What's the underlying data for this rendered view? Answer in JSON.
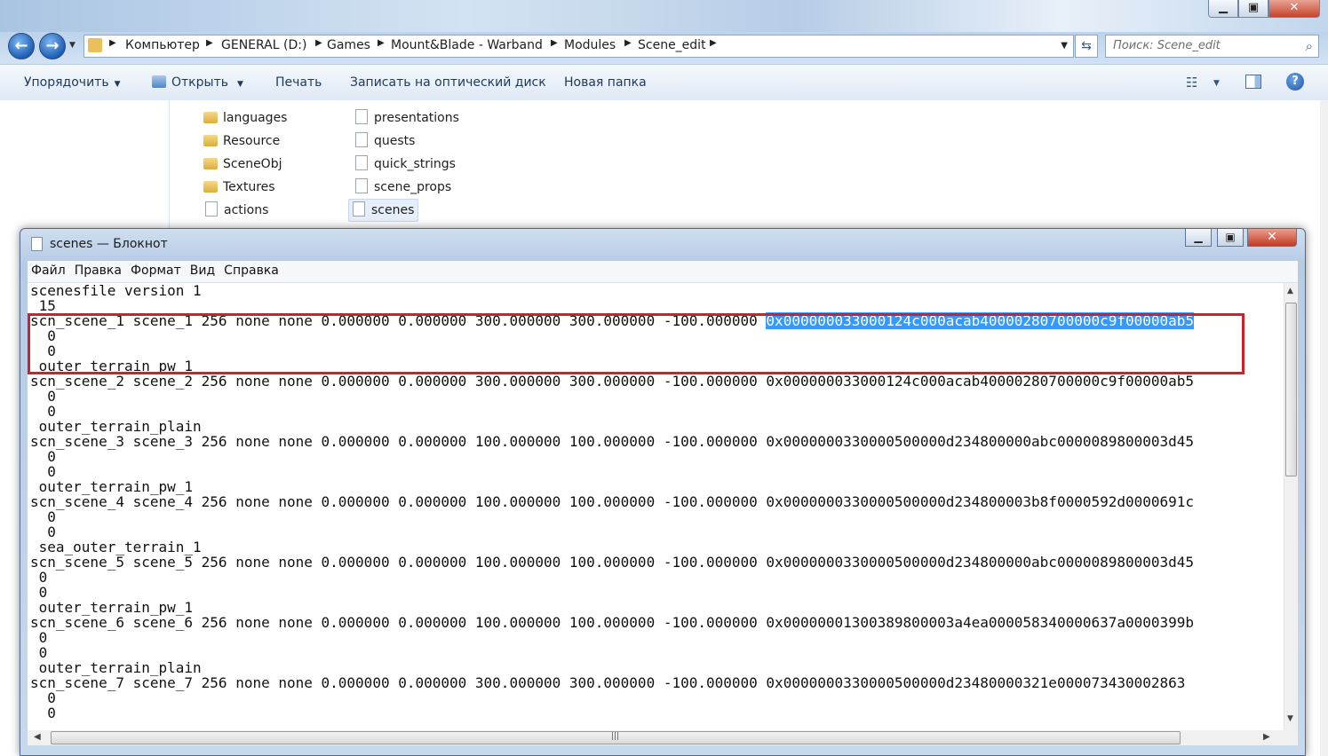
{
  "explorer": {
    "breadcrumb": [
      "Компьютер",
      "GENERAL (D:)",
      "Games",
      "Mount&Blade - Warband",
      "Modules",
      "Scene_edit"
    ],
    "search_placeholder": "Поиск: Scene_edit",
    "toolbar": {
      "organize": "Упорядочить",
      "open": "Открыть",
      "print": "Печать",
      "burn": "Записать на оптический диск",
      "new_folder": "Новая папка"
    },
    "files_col1": [
      {
        "name": "languages",
        "type": "folder"
      },
      {
        "name": "Resource",
        "type": "folder"
      },
      {
        "name": "SceneObj",
        "type": "folder"
      },
      {
        "name": "Textures",
        "type": "folder"
      },
      {
        "name": "actions",
        "type": "file"
      }
    ],
    "files_col2": [
      {
        "name": "presentations",
        "type": "file"
      },
      {
        "name": "quests",
        "type": "file"
      },
      {
        "name": "quick_strings",
        "type": "file"
      },
      {
        "name": "scene_props",
        "type": "file"
      },
      {
        "name": "scenes",
        "type": "file",
        "selected": true
      }
    ]
  },
  "notepad": {
    "title": "scenes — Блокнот",
    "menu": [
      "Файл",
      "Правка",
      "Формат",
      "Вид",
      "Справка"
    ],
    "selected_text": "0x000000033000124c000acab40000280700000c9f00000ab5",
    "lines": [
      "scenesfile version 1",
      " 15",
      "scn_scene_1 scene_1 256 none none 0.000000 0.000000 300.000000 300.000000 -100.000000 ",
      "  0",
      "  0",
      " outer_terrain_pw_1",
      "scn_scene_2 scene_2 256 none none 0.000000 0.000000 300.000000 300.000000 -100.000000 0x000000033000124c000acab40000280700000c9f00000ab5",
      "  0",
      "  0",
      " outer_terrain_plain",
      "scn_scene_3 scene_3 256 none none 0.000000 0.000000 100.000000 100.000000 -100.000000 0x0000000330000500000d234800000abc0000089800003d45",
      "  0",
      "  0",
      " outer_terrain_pw_1",
      "scn_scene_4 scene_4 256 none none 0.000000 0.000000 100.000000 100.000000 -100.000000 0x0000000330000500000d234800003b8f0000592d0000691c",
      "  0",
      "  0",
      " sea_outer_terrain_1",
      "scn_scene_5 scene_5 256 none none 0.000000 0.000000 100.000000 100.000000 -100.000000 0x0000000330000500000d234800000abc0000089800003d45",
      " 0",
      " 0",
      " outer_terrain_pw_1",
      "scn_scene_6 scene_6 256 none none 0.000000 0.000000 100.000000 100.000000 -100.000000 0x00000001300389800003a4ea000058340000637a0000399b",
      " 0",
      " 0",
      " outer_terrain_plain",
      "scn_scene_7 scene_7 256 none none 0.000000 0.000000 300.000000 300.000000 -100.000000 0x0000000330000500000d23480000321e000073430002863",
      "  0",
      "  0"
    ]
  }
}
